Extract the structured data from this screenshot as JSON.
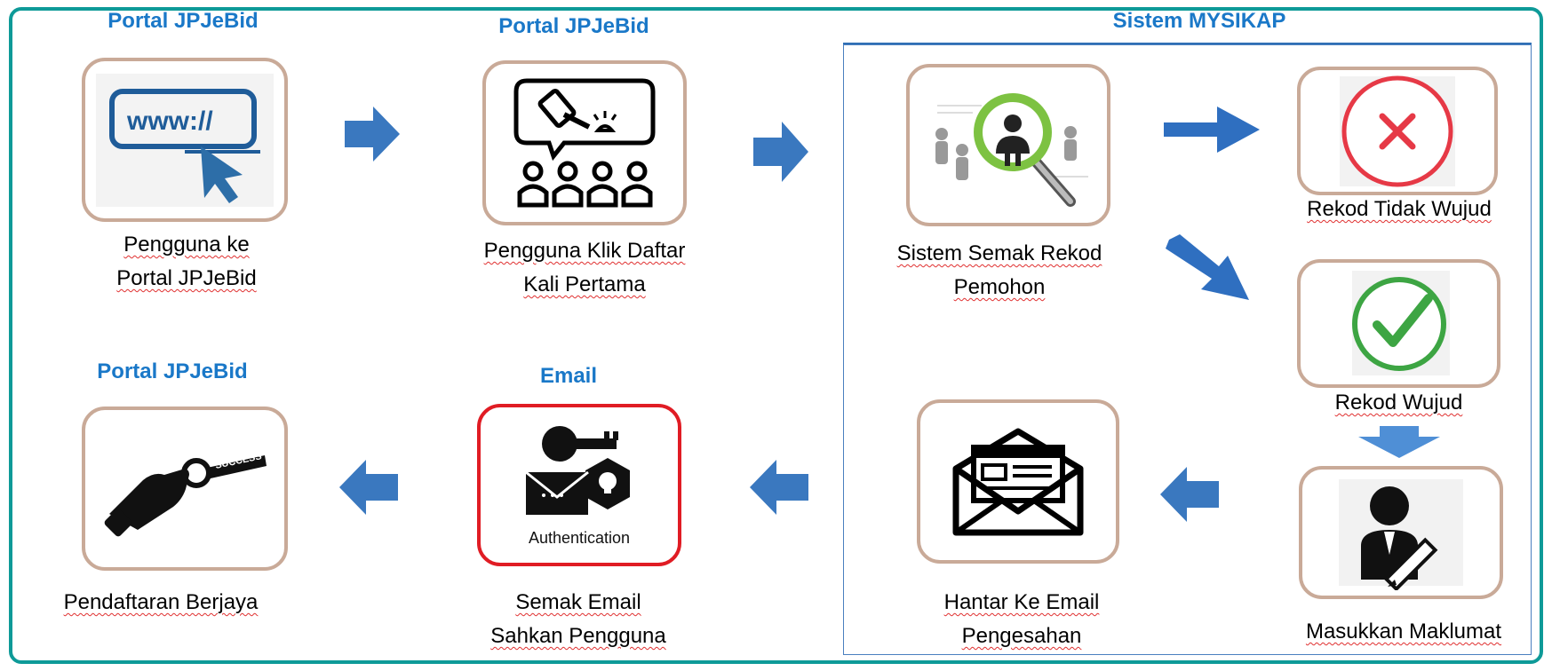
{
  "headings": {
    "portal_1": "Portal JPJeBid",
    "portal_2": "Portal JPJeBid",
    "sistem": "Sistem MYSIKAP",
    "portal_3": "Portal JPJeBid",
    "email": "Email"
  },
  "steps": {
    "pengguna_portal": {
      "line1": "Pengguna ke",
      "line2": "Portal JPJeBid"
    },
    "klik_daftar": {
      "line1": "Pengguna Klik Daftar",
      "line2": "Kali Pertama"
    },
    "semak_rekod": {
      "line1": "Sistem Semak Rekod",
      "line2": "Pemohon"
    },
    "tidak_wujud": {
      "line1": "Rekod Tidak Wujud"
    },
    "wujud": {
      "line1": "Rekod Wujud"
    },
    "masukkan": {
      "line1": "Masukkan Maklumat"
    },
    "hantar_email": {
      "line1": "Hantar Ke Email",
      "line2": "Pengesahan"
    },
    "semak_email": {
      "line1": "Semak Email",
      "line2": "Sahkan Pengguna"
    },
    "berjaya": {
      "line1": "Pendaftaran Berjaya"
    }
  },
  "icon_labels": {
    "url": "www://",
    "authentication": "Authentication",
    "success": "SUCCESS"
  },
  "icons": [
    "web-browser-icon",
    "auction-group-icon",
    "search-person-icon",
    "cross-icon",
    "check-icon",
    "user-edit-icon",
    "envelope-icon",
    "authentication-icon",
    "success-key-icon"
  ],
  "colors": {
    "frame": "#0e9a98",
    "heading": "#1a78c8",
    "node_border": "#c9aa98",
    "auth_border": "#e01c24",
    "arrow": "#3a78bf"
  }
}
